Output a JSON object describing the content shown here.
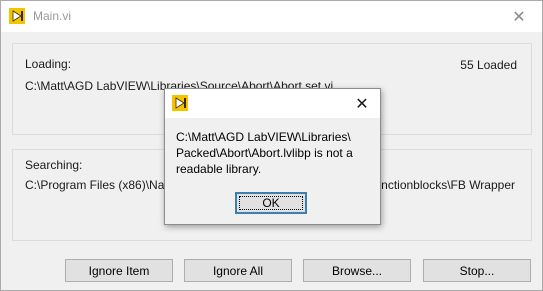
{
  "window": {
    "title": "Main.vi",
    "close_glyph": "✕",
    "icon": "labview-icon"
  },
  "loading": {
    "label": "Loading:",
    "count": "55 Loaded",
    "path": "C:\\Matt\\AGD LabVIEW\\Libraries\\Source\\Abort\\Abort.set.vi"
  },
  "searching": {
    "label": "Searching:",
    "path_left": "C:\\Program Files (x86)\\Nat",
    "path_right": "nctionblocks\\FB Wrapper"
  },
  "buttons": {
    "ignore_item": "Ignore Item",
    "ignore_all": "Ignore All",
    "browse": "Browse...",
    "stop": "Stop..."
  },
  "dialog": {
    "icon": "labview-icon",
    "close_glyph": "✕",
    "message_lines": [
      "C:\\Matt\\AGD LabVIEW\\Libraries\\",
      "Packed\\Abort\\Abort.lvlibp is not a",
      "readable library."
    ],
    "ok_label": "OK"
  },
  "colors": {
    "accent_icon": "#f5c400",
    "focus_border": "#3c7fb1"
  }
}
